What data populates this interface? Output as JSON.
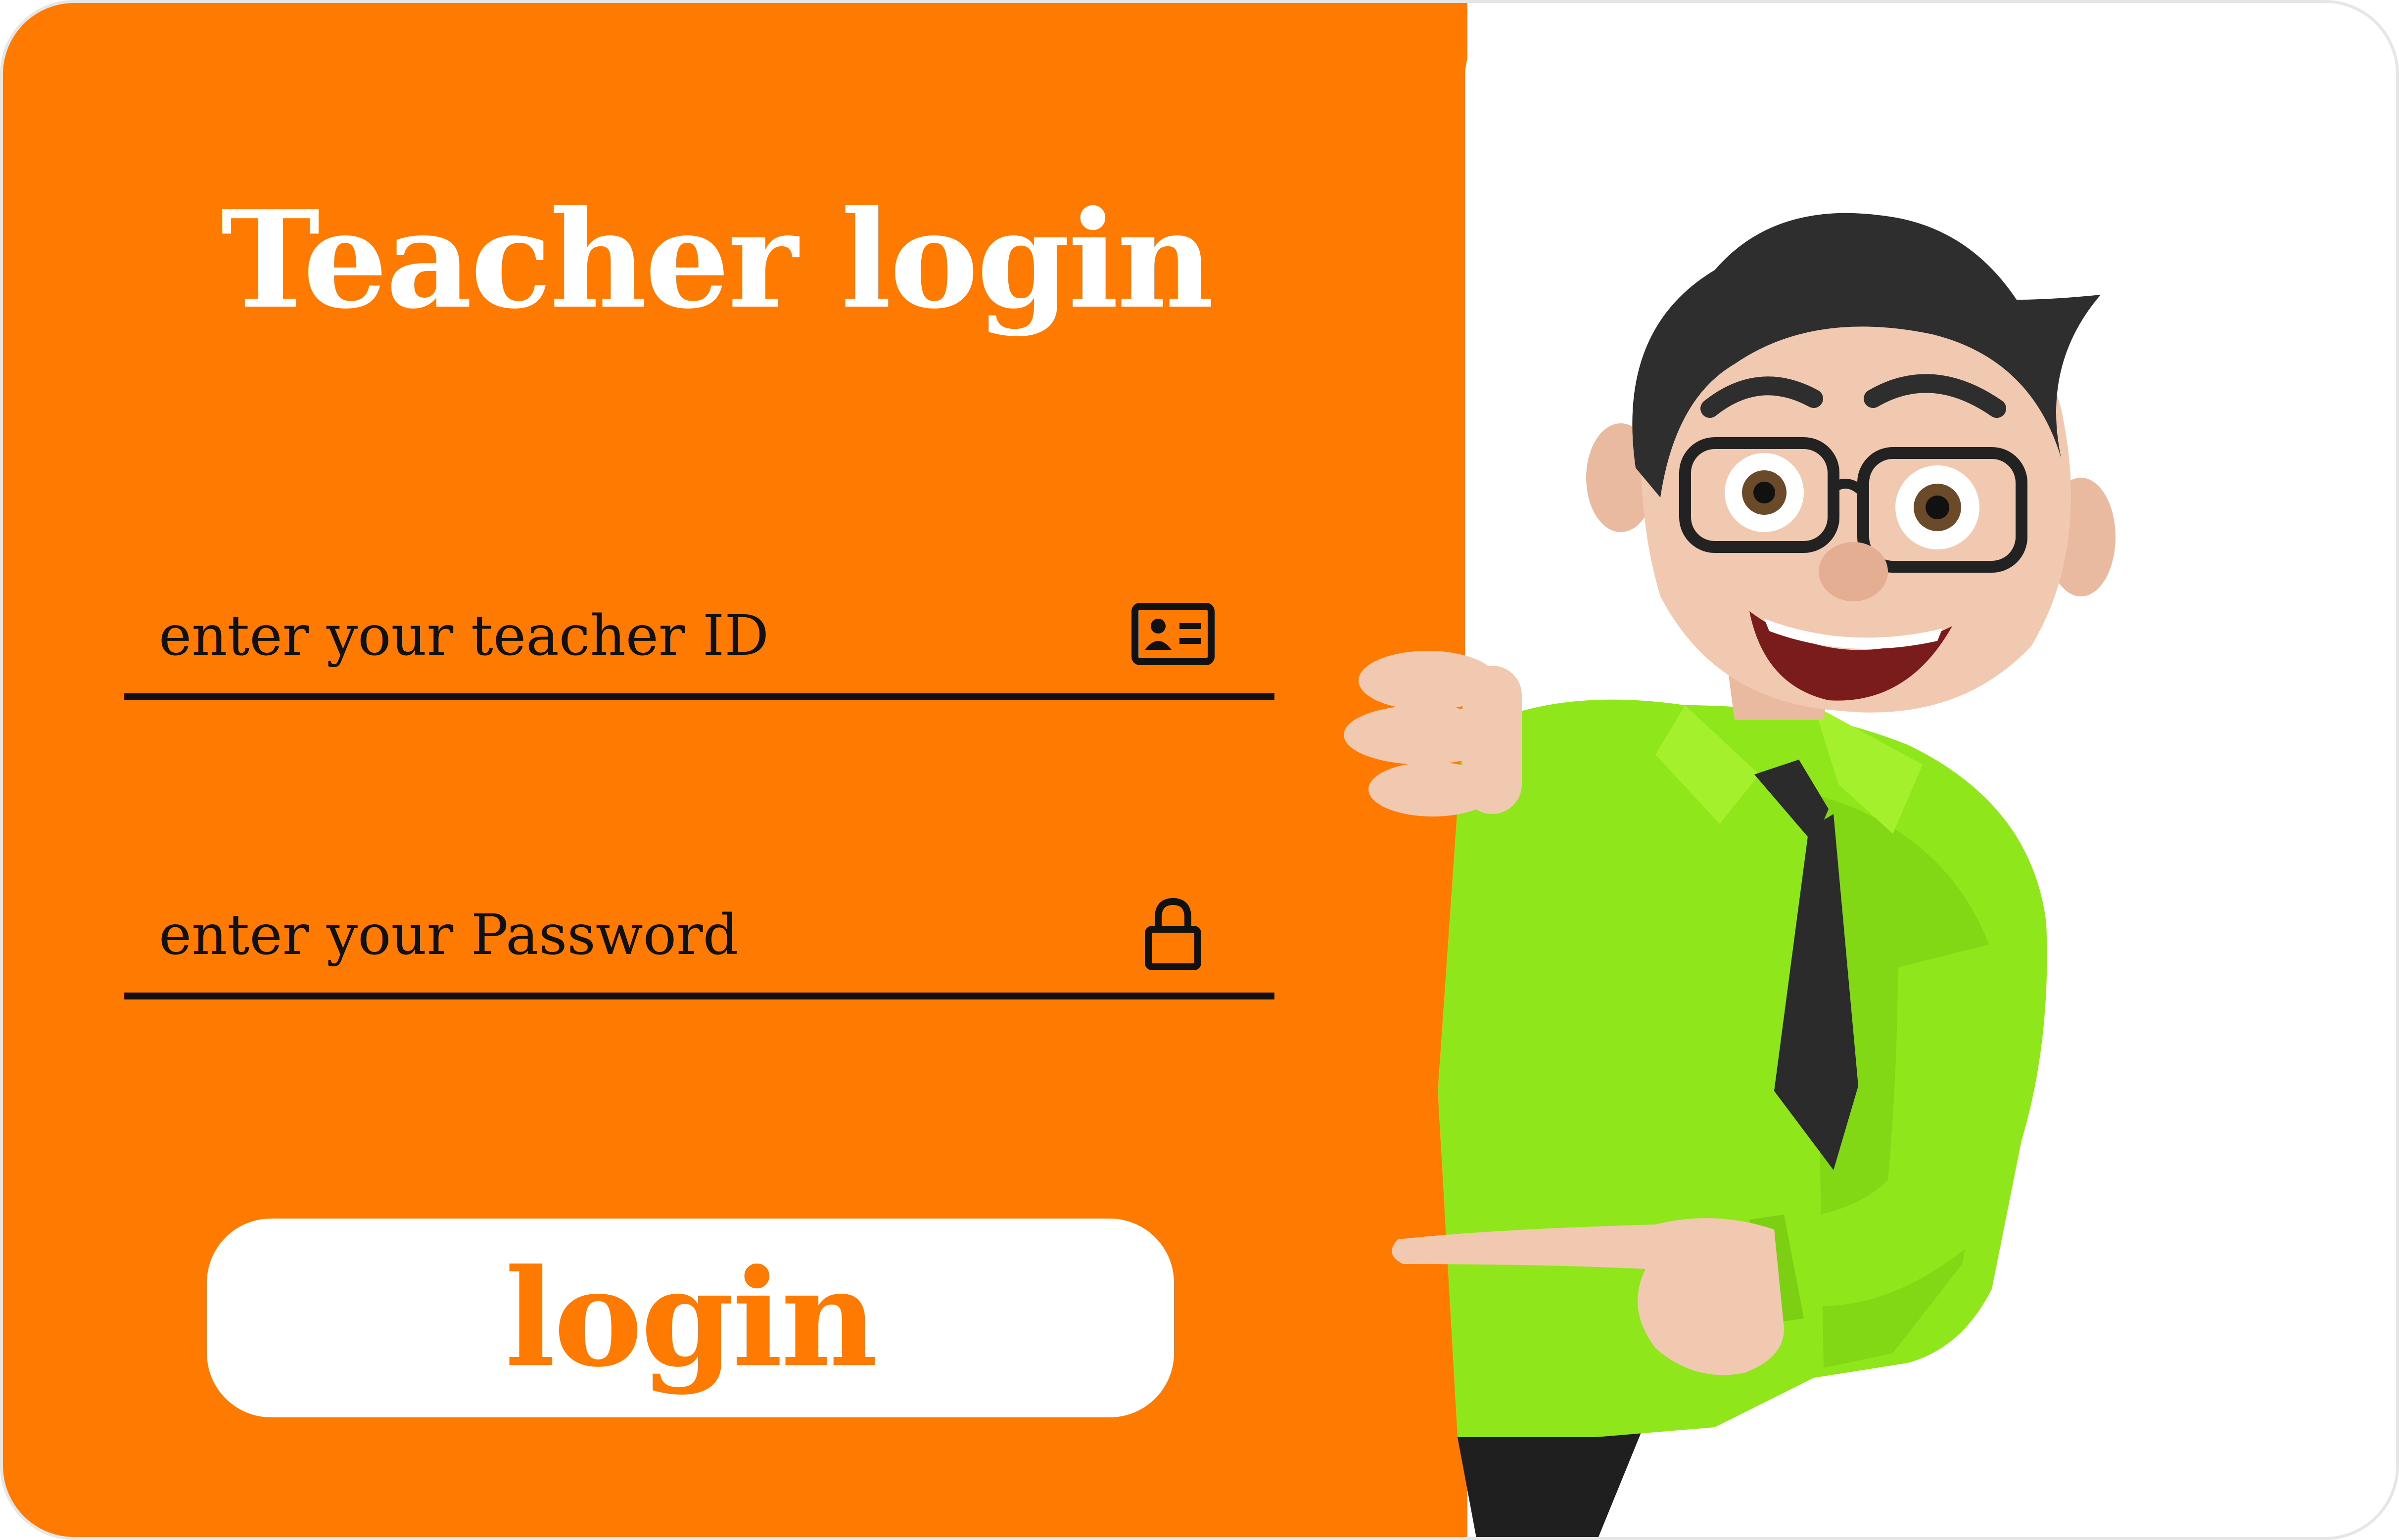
{
  "login_form": {
    "title": "Teacher login",
    "teacher_id_placeholder": "enter your teacher ID",
    "password_placeholder": "enter your Password",
    "login_label": "login"
  },
  "icons": {
    "teacher_id": "id-card-icon",
    "password": "lock-icon"
  },
  "colors": {
    "accent": "#ff7a00",
    "panel_text": "#ffffff",
    "field_text": "#111111",
    "mascot_shirt": "#8ee61b",
    "mascot_tie": "#2b2b2b"
  }
}
